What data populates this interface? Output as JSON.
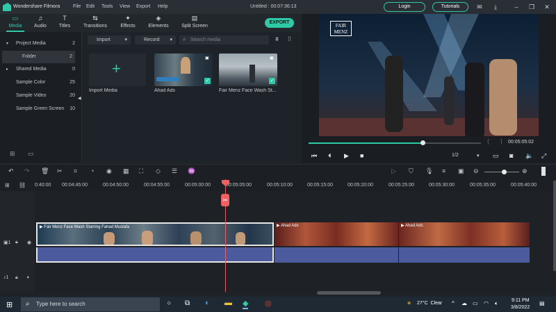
{
  "app": {
    "name": "Wondershare Filmora",
    "menu": [
      "File",
      "Edit",
      "Tools",
      "View",
      "Export",
      "Help"
    ],
    "doc_title": "Untitled : 00:07:36:13",
    "login": "Login",
    "tutorials": "Tutorials"
  },
  "tabs": [
    {
      "label": "Media",
      "icon": "folder-icon"
    },
    {
      "label": "Audio",
      "icon": "music-icon"
    },
    {
      "label": "Titles",
      "icon": "text-icon"
    },
    {
      "label": "Transitions",
      "icon": "transition-icon"
    },
    {
      "label": "Effects",
      "icon": "effects-icon"
    },
    {
      "label": "Elements",
      "icon": "elements-icon"
    },
    {
      "label": "Split Screen",
      "icon": "split-screen-icon"
    }
  ],
  "export_label": "EXPORT",
  "sidebar": [
    {
      "label": "Project Media",
      "count": "2"
    },
    {
      "label": "Folder",
      "count": "2"
    },
    {
      "label": "Shared Media",
      "count": "0"
    },
    {
      "label": "Sample Color",
      "count": "25"
    },
    {
      "label": "Sample Video",
      "count": "20"
    },
    {
      "label": "Sample Green Screen",
      "count": "10"
    }
  ],
  "media": {
    "import_dropdown": "Import",
    "record_dropdown": "Record",
    "search_placeholder": "Search media",
    "import_label": "Import Media",
    "items": [
      {
        "label": "Ahad Ads"
      },
      {
        "label": "Fair Menz Face Wash St..."
      }
    ]
  },
  "preview": {
    "watermark_line1": "FAIR",
    "watermark_line2": "MENZ",
    "timecode": "00:05:05:02",
    "quality": "1/2",
    "progress": 0.67
  },
  "ruler": [
    "0:40:00",
    "00:04:45:00",
    "00:04:50:00",
    "00:04:55:00",
    "00:05:00:00",
    "00:05:05:00",
    "00:05:10:00",
    "00:05:15:00",
    "00:05:20:00",
    "00:05:25:00",
    "00:05:30:00",
    "00:05:35:00",
    "00:05:40:00"
  ],
  "clips": [
    {
      "title": "Fair Menz Face Wash Starring Fahad Mustafa"
    },
    {
      "title": "Ahad Ads"
    },
    {
      "title": "Ahad Ads"
    }
  ],
  "tracks": {
    "video_label": "1",
    "audio_label": "1"
  },
  "taskbar": {
    "search_placeholder": "Type here to search",
    "weather": "27°C  Clear",
    "time": "9:11 PM",
    "date": "3/8/2022"
  }
}
